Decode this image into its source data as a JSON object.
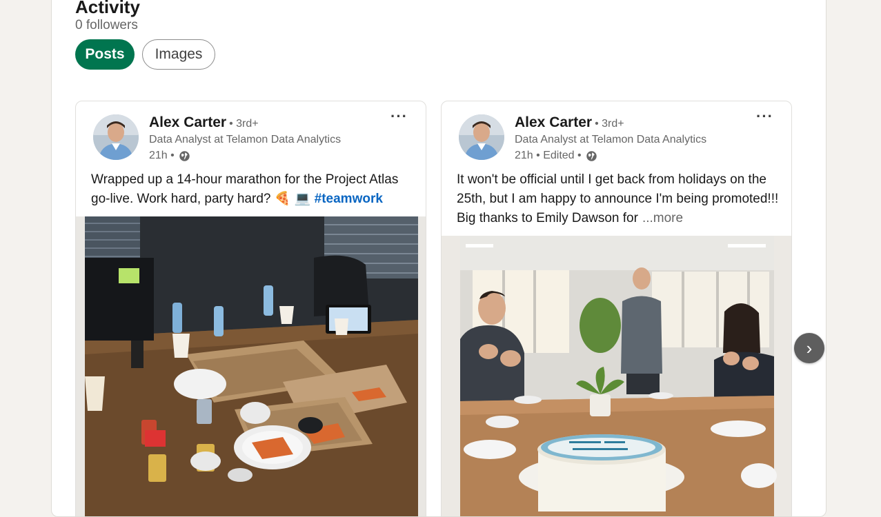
{
  "activity": {
    "title": "Activity",
    "followers": "0 followers",
    "tabs": [
      {
        "label": "Posts",
        "active": true
      },
      {
        "label": "Images",
        "active": false
      }
    ]
  },
  "posts": [
    {
      "author": "Alex Carter",
      "degree": "• 3rd+",
      "headline": "Data Analyst at Telamon Data Analytics",
      "time": "21h •",
      "text": "Wrapped up a 14-hour marathon for the Project Atlas go-live. Work hard, party hard? 🍕 💻",
      "hashtag": "#teamwork",
      "menu": "···",
      "image": "late-night office desk with empty pizza boxes and soda cans"
    },
    {
      "author": "Alex Carter",
      "degree": "• 3rd+",
      "headline": "Data Analyst at Telamon Data Analytics",
      "time": "21h • Edited •",
      "text": "It won't be official until I get back from holidays on the 25th, but I am happy to announce I'm being promoted!!! Big thanks to Emily Dawson for",
      "see_more": "...more",
      "menu": "···",
      "image": "colleagues clapping around a celebration cake in an office"
    }
  ],
  "carousel": {
    "next_label": "›"
  },
  "colors": {
    "accent": "#01754f",
    "link": "#0a66c2",
    "background": "#f4f2ee"
  },
  "icons": [
    "globe-icon",
    "more-options-icon",
    "chevron-right-icon"
  ]
}
